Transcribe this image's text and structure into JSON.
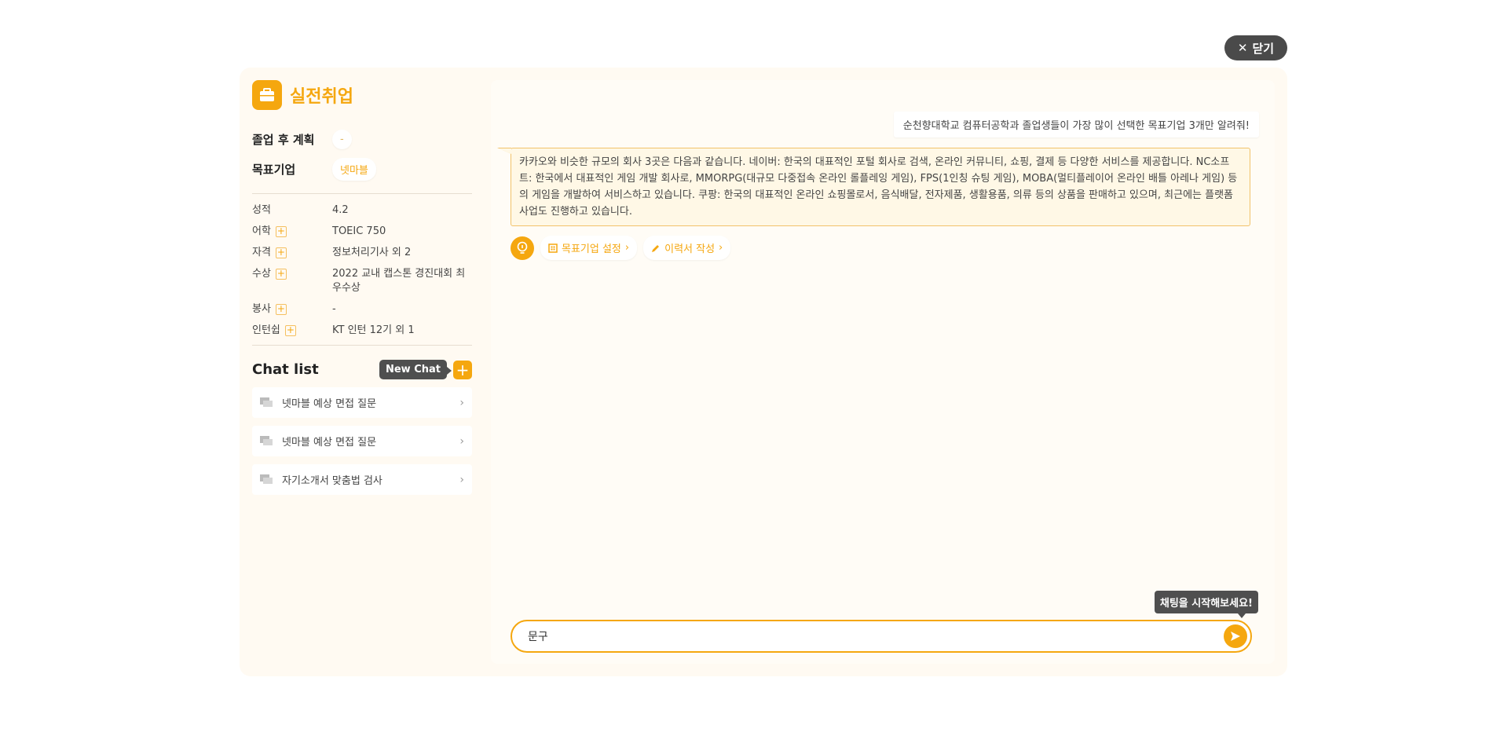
{
  "close": {
    "label": "닫기"
  },
  "brand": {
    "title": "실전취업"
  },
  "plan": {
    "after_grad_label": "졸업 후 계획",
    "after_grad_value": "-",
    "target_label": "목표기업",
    "target_value": "넷마블"
  },
  "specs": [
    {
      "key": "성적",
      "value": "4.2",
      "addable": false
    },
    {
      "key": "어학",
      "value": "TOEIC 750",
      "addable": true
    },
    {
      "key": "자격",
      "value": "정보처리기사 외 2",
      "addable": true
    },
    {
      "key": "수상",
      "value": "2022 교내 캡스톤 경진대회 최우수상",
      "addable": true
    },
    {
      "key": "봉사",
      "value": "-",
      "addable": true
    },
    {
      "key": "인턴쉽",
      "value": "KT 인턴 12기 외 1",
      "addable": true
    }
  ],
  "chat_list": {
    "title": "Chat list",
    "new_chat_tooltip": "New Chat",
    "items": [
      {
        "label": "넷마블 예상 면접 질문"
      },
      {
        "label": "넷마블 예상 면접 질문"
      },
      {
        "label": "자기소개서 맞춤법 검사"
      }
    ]
  },
  "conversation": {
    "user_message": "순천향대학교 컴퓨터공학과 졸업생들이 가장 많이 선택한 목표기업 3개만 알려줘!",
    "bot_message": "카카오와 비슷한 규모의 회사 3곳은 다음과 같습니다. 네이버: 한국의 대표적인 포털 회사로 검색, 온라인 커뮤니티, 쇼핑, 결제 등 다양한 서비스를 제공합니다. NC소프트: 한국에서 대표적인 게임 개발 회사로, MMORPG(대규모 다중접속 온라인 롤플레잉 게임), FPS(1인칭 슈팅 게임), MOBA(멀티플레이어 온라인 배틀 아레나 게임) 등의 게임을 개발하여 서비스하고 있습니다. 쿠팡: 한국의 대표적인 온라인 쇼핑몰로서, 음식배달, 전자제품, 생활용품, 의류 등의 상품을 판매하고 있으며, 최근에는 플랫폼 사업도 진행하고 있습니다.",
    "suggestions": [
      {
        "label": "목표기업 설정",
        "icon": "building-icon"
      },
      {
        "label": "이력서 작성",
        "icon": "pencil-icon"
      }
    ]
  },
  "input": {
    "hint": "채팅을 시작해보세요!",
    "value": "문구"
  },
  "colors": {
    "accent": "#f5a70f",
    "panel": "#fffaf2"
  }
}
